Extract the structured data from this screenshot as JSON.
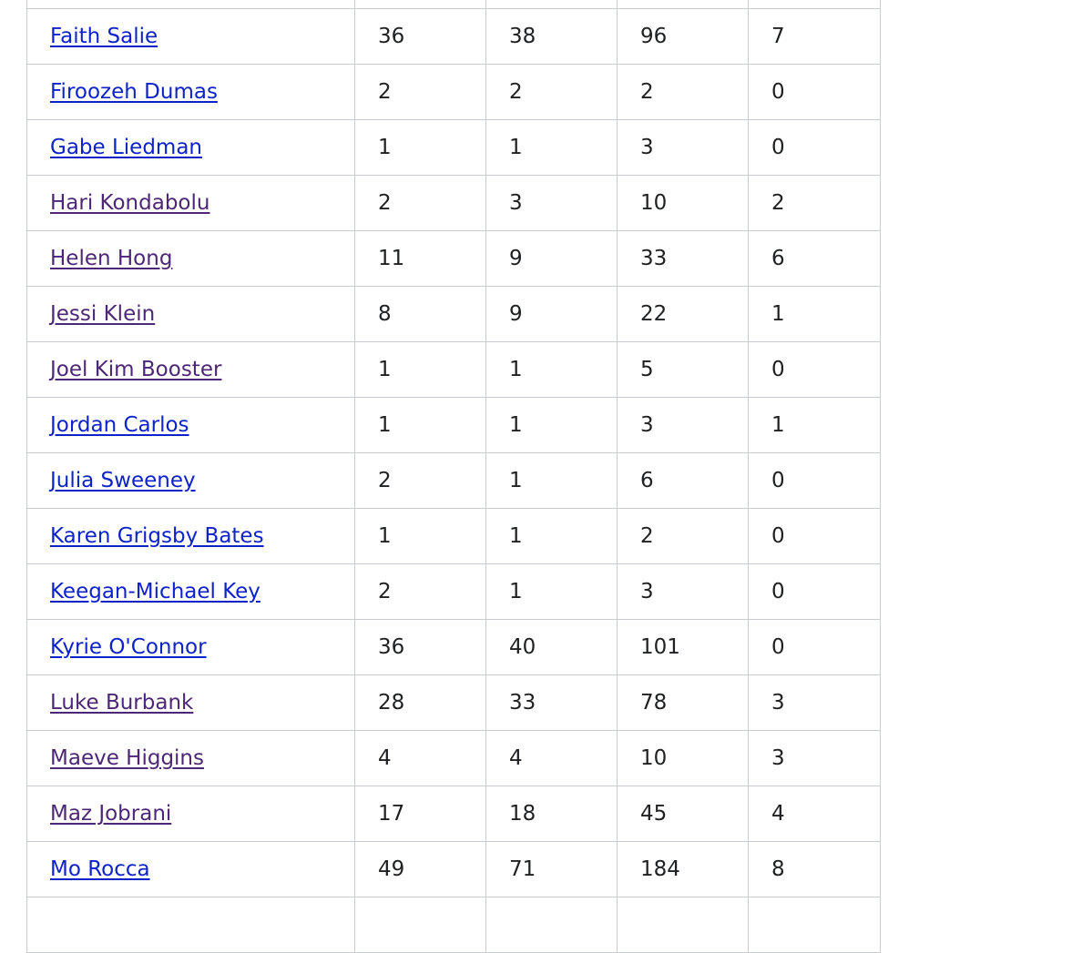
{
  "colors": {
    "link_unvisited": "#0d23c9",
    "link_visited": "#4d2777",
    "border": "#c8ccd1",
    "text": "#202122"
  },
  "table": {
    "rows": [
      {
        "name": "",
        "visited": false,
        "values": [
          "",
          "",
          "",
          ""
        ]
      },
      {
        "name": "Faith Salie",
        "visited": false,
        "values": [
          "36",
          "38",
          "96",
          "7"
        ]
      },
      {
        "name": "Firoozeh Dumas",
        "visited": false,
        "values": [
          "2",
          "2",
          "2",
          "0"
        ]
      },
      {
        "name": "Gabe Liedman",
        "visited": false,
        "values": [
          "1",
          "1",
          "3",
          "0"
        ]
      },
      {
        "name": "Hari Kondabolu",
        "visited": true,
        "values": [
          "2",
          "3",
          "10",
          "2"
        ]
      },
      {
        "name": "Helen Hong",
        "visited": true,
        "values": [
          "11",
          "9",
          "33",
          "6"
        ]
      },
      {
        "name": "Jessi Klein",
        "visited": true,
        "values": [
          "8",
          "9",
          "22",
          "1"
        ]
      },
      {
        "name": "Joel Kim Booster",
        "visited": true,
        "values": [
          "1",
          "1",
          "5",
          "0"
        ]
      },
      {
        "name": "Jordan Carlos",
        "visited": false,
        "values": [
          "1",
          "1",
          "3",
          "1"
        ]
      },
      {
        "name": "Julia Sweeney",
        "visited": false,
        "values": [
          "2",
          "1",
          "6",
          "0"
        ]
      },
      {
        "name": "Karen Grigsby Bates",
        "visited": false,
        "values": [
          "1",
          "1",
          "2",
          "0"
        ]
      },
      {
        "name": "Keegan-Michael Key",
        "visited": false,
        "values": [
          "2",
          "1",
          "3",
          "0"
        ]
      },
      {
        "name": "Kyrie O'Connor",
        "visited": false,
        "values": [
          "36",
          "40",
          "101",
          "0"
        ]
      },
      {
        "name": "Luke Burbank",
        "visited": true,
        "values": [
          "28",
          "33",
          "78",
          "3"
        ]
      },
      {
        "name": "Maeve Higgins",
        "visited": true,
        "values": [
          "4",
          "4",
          "10",
          "3"
        ]
      },
      {
        "name": "Maz Jobrani",
        "visited": true,
        "values": [
          "17",
          "18",
          "45",
          "4"
        ]
      },
      {
        "name": "Mo Rocca",
        "visited": false,
        "values": [
          "49",
          "71",
          "184",
          "8"
        ]
      },
      {
        "name": "",
        "visited": false,
        "values": [
          "",
          "",
          "",
          ""
        ]
      }
    ]
  }
}
